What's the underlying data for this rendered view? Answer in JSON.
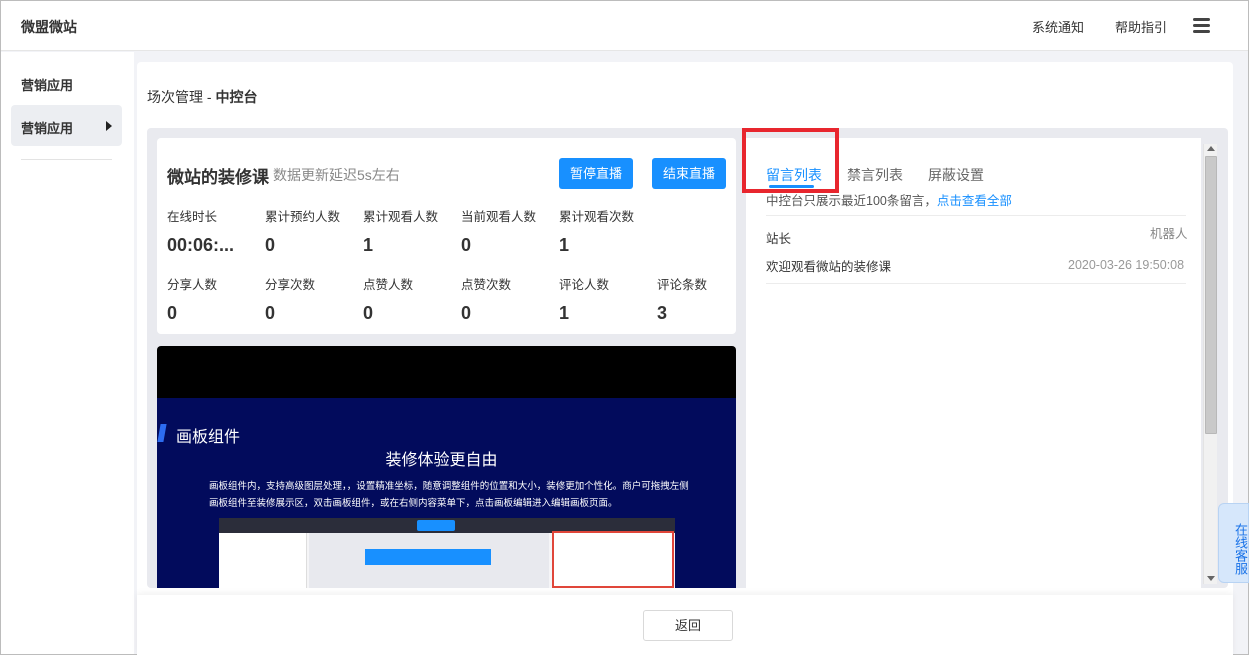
{
  "header": {
    "brand": "微盟微站",
    "nav": [
      {
        "label": "系统通知"
      },
      {
        "label": "帮助指引"
      }
    ],
    "menu_icon": "hamburger-icon"
  },
  "sidebar": {
    "title": "营销应用",
    "items": [
      {
        "label": "营销应用"
      }
    ],
    "arrow_icon": "caret-right-icon"
  },
  "breadcrumb": {
    "parent": "场次管理",
    "separator": "-",
    "current": "中控台"
  },
  "live": {
    "course_title": "微站的装修课",
    "delay_note": "数据更新延迟5s左右",
    "pause_label": "暂停直播",
    "end_label": "结束直播",
    "stats_row1": [
      {
        "label": "在线时长",
        "value": "00:06:..."
      },
      {
        "label": "累计预约人数",
        "value": "0"
      },
      {
        "label": "累计观看人数",
        "value": "1"
      },
      {
        "label": "当前观看人数",
        "value": "0"
      },
      {
        "label": "累计观看次数",
        "value": "1"
      }
    ],
    "stats_row2": [
      {
        "label": "分享人数",
        "value": "0"
      },
      {
        "label": "分享次数",
        "value": "0"
      },
      {
        "label": "点赞人数",
        "value": "0"
      },
      {
        "label": "点赞次数",
        "value": "0"
      },
      {
        "label": "评论人数",
        "value": "1"
      },
      {
        "label": "评论条数",
        "value": "3"
      }
    ],
    "video": {
      "title1": "画板组件",
      "title2": "装修体验更自由",
      "desc": "画板组件内，支持高级图层处理，，设置精准坐标，随意调整组件的位置和大小，装修更加个性化。商户可拖拽左侧画板组件至装修展示区，双击画板组件，或在右侧内容菜单下，点击画板编辑进入编辑画板页面。"
    }
  },
  "comments": {
    "tabs": [
      {
        "label": "留言列表",
        "active": true
      },
      {
        "label": "禁言列表",
        "active": false
      },
      {
        "label": "屏蔽设置",
        "active": false
      }
    ],
    "notice": "中控台只展示最近100条留言，",
    "notice_link": "点击查看全部",
    "items": [
      {
        "author": "站长",
        "tag": "机器人",
        "text": "欢迎观看微站的装修课",
        "time": "2020-03-26 19:50:08"
      }
    ]
  },
  "footer": {
    "back_label": "返回"
  },
  "customer_service": {
    "label": "在线客服"
  },
  "colors": {
    "accent": "#1890ff",
    "highlight": "#e8262e",
    "video_bg": "#020b5c"
  }
}
